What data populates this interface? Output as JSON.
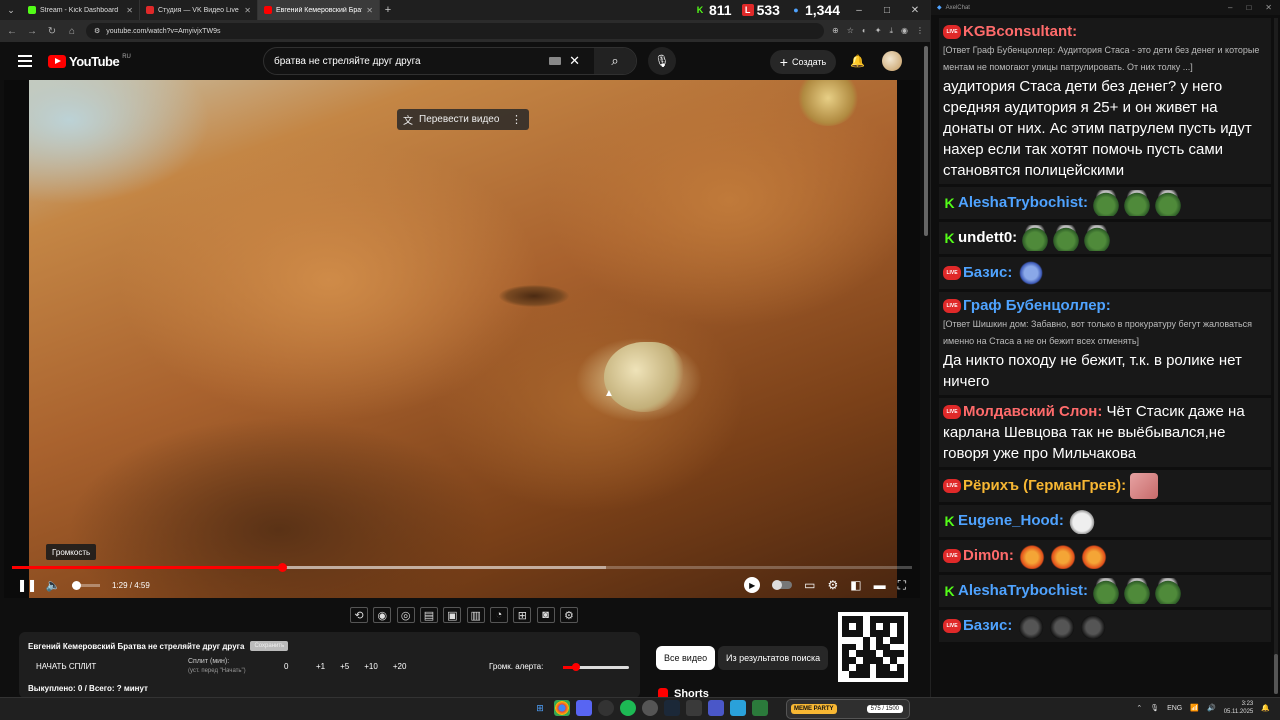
{
  "browser": {
    "tabs": [
      {
        "title": "Stream - Kick Dashboard",
        "color": "#53fc18"
      },
      {
        "title": "Студия — VK Видео Live",
        "color": "#e02929"
      },
      {
        "title": "Евгений Кемеровский Брат",
        "color": "#ff0000"
      }
    ],
    "url": "youtube.com/watch?v=AmyivjxTW9s"
  },
  "stats": {
    "kick_viewers": "811",
    "vk_viewers": "533",
    "total_viewers": "1,344"
  },
  "youtube": {
    "logo_text": "YouTube",
    "region": "RU",
    "search_query": "братва не стреляйте друг друга",
    "create_label": "Создать",
    "translate_label": "Перевести видео",
    "volume_tooltip": "Громкость",
    "time": "1:29 / 4:59",
    "progress_played": 0.3,
    "progress_buffered": 0.66,
    "volume_level": 0.1
  },
  "split_panel": {
    "title": "Евгений Кемеровский Братва не стреляйте друг друга",
    "badge": "Сохранить",
    "start_label": "НАЧАТЬ СПЛИТ",
    "split_min_label": "Сплит (мин):",
    "split_min_hint": "(уст. перед \"Начать\")",
    "split_value": "0",
    "increments": [
      "+1",
      "+5",
      "+10",
      "+20"
    ],
    "alert_label": "Громк. алерта:",
    "alert_level": 0.2,
    "bought": "Выкуплено: 0 / Всего: ? минут"
  },
  "filters": {
    "all": "Все видео",
    "search": "Из результатов поиска"
  },
  "shorts_label": "Shorts",
  "chat": {
    "title": "AxelChat",
    "messages": [
      {
        "platform": "live",
        "nick": "KGBconsultant:",
        "color": "#ff6b6b",
        "reply": "[Ответ Граф Бубенцоллер: Аудитория Стаса - это дети без денег и которые ментам не помогают улицы патрулировать. От них толку ...]",
        "text": "аудитория Стаса дети без денег? у него средняя аудитория я 25+ и он живет на донаты от них. Ас этим патрулем пусть идут нахер если так хотят помочь пусть сами становятся полицейскими"
      },
      {
        "platform": "kick",
        "nick": "AleshaTrybochist:",
        "color": "#4fa3ff",
        "emotes": [
          "pepe",
          "pepe",
          "pepe"
        ]
      },
      {
        "platform": "kick",
        "nick": "undett0:",
        "color": "#ffffff",
        "emotes": [
          "pepe",
          "pepe",
          "pepe"
        ]
      },
      {
        "platform": "live",
        "nick": "Базис:",
        "color": "#4fa3ff",
        "emotes": [
          "blue"
        ]
      },
      {
        "platform": "live",
        "nick": "Граф Бубенцоллер:",
        "color": "#4fa3ff",
        "reply": "[Ответ Шишкин дом: Забавно, вот только в прокуратуру бегут жаловаться именно на Стаса а не он бежит всех отменять]",
        "text": "Да никто походу не бежит, т.к. в ролике нет ничего"
      },
      {
        "platform": "live",
        "nick": "Молдавский Слон:",
        "color": "#ff6b6b",
        "text": "Чёт Стасик даже на карлана Шевцова так не выёбывался,не говоря уже про Мильчакова"
      },
      {
        "platform": "live",
        "nick": "Рёрихъ (ГерманГрев):",
        "color": "#f7b733",
        "emotes": [
          "face"
        ]
      },
      {
        "platform": "kick",
        "nick": "Eugene_Hood:",
        "color": "#4fa3ff",
        "emotes": [
          "cat"
        ]
      },
      {
        "platform": "live",
        "nick": "Dim0n:",
        "color": "#ff6b6b",
        "emotes": [
          "blob",
          "blob",
          "blob"
        ]
      },
      {
        "platform": "kick",
        "nick": "AleshaTrybochist:",
        "color": "#4fa3ff",
        "emotes": [
          "pepe",
          "pepe",
          "pepe"
        ]
      },
      {
        "platform": "live",
        "nick": "Базис:",
        "color": "#4fa3ff",
        "emotes": [
          "dark",
          "dark",
          "dark"
        ]
      }
    ]
  },
  "taskbar": {
    "meme_label": "MEME PARTY",
    "meme_progress": "575 / 1500",
    "lang": "ENG",
    "time": "3:23",
    "date": "05.11.2025"
  }
}
